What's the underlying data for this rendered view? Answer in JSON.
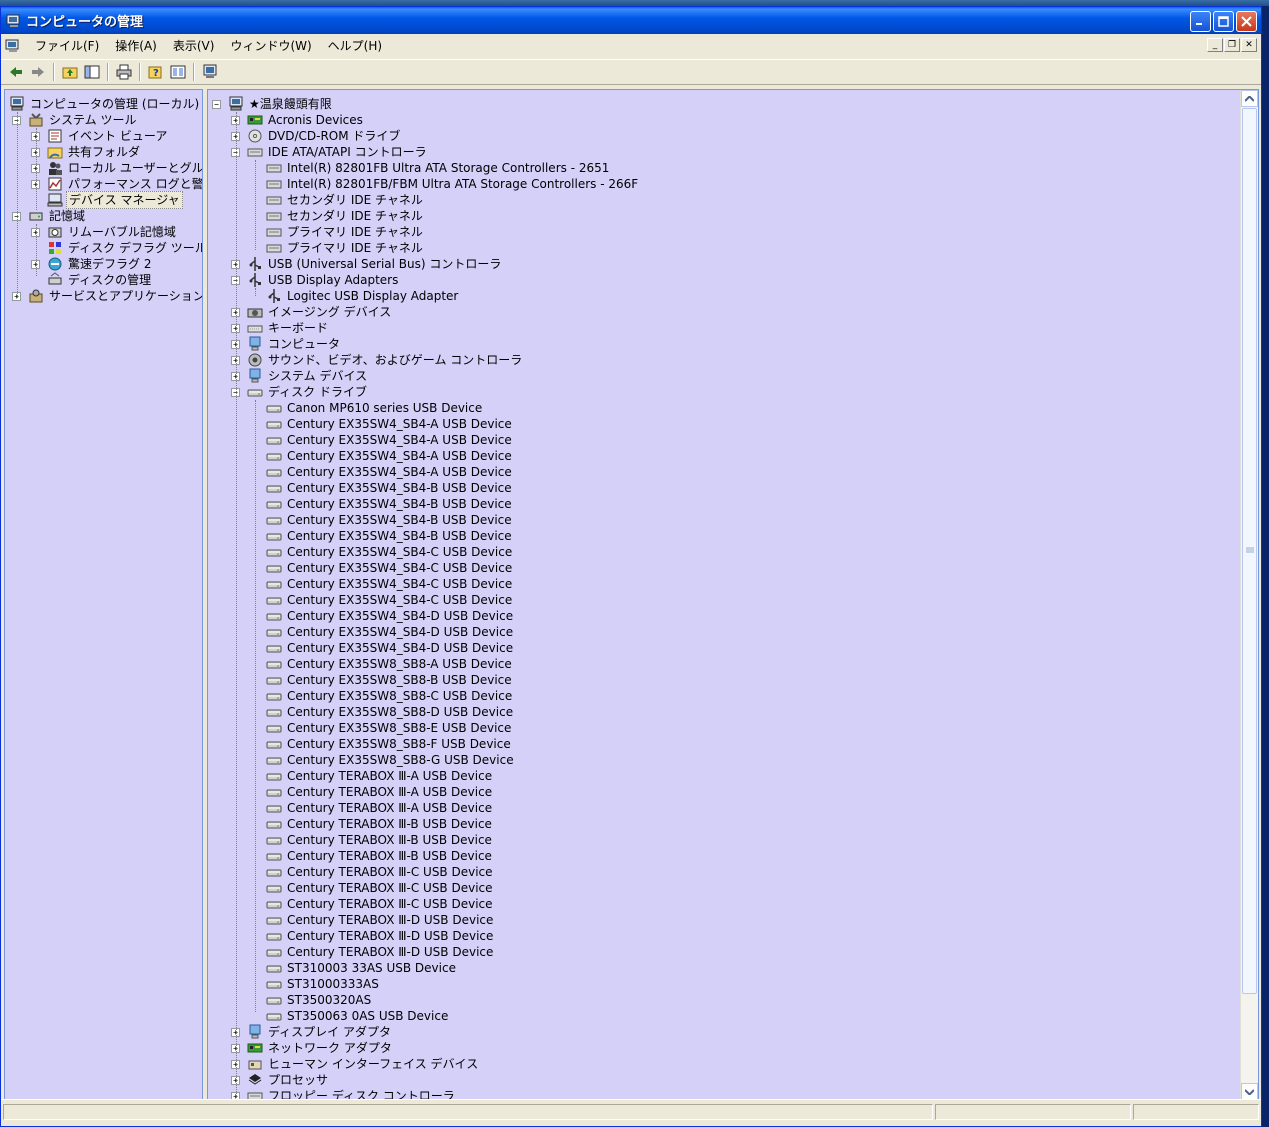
{
  "window": {
    "title": "コンピュータの管理"
  },
  "menu": [
    "ファイル(F)",
    "操作(A)",
    "表示(V)",
    "ウィンドウ(W)",
    "ヘルプ(H)"
  ],
  "toolbar": [
    "back-arrow-icon",
    "forward-arrow-icon",
    "up-folder-icon",
    "show-tree-icon",
    "print-icon",
    "help-icon",
    "properties-icon",
    "computer-icon"
  ],
  "left_tree": [
    {
      "label": "コンピュータの管理 (ローカル)",
      "level": 0,
      "icon": "computer-icon",
      "exp": ""
    },
    {
      "label": "システム ツール",
      "level": 1,
      "icon": "tools-icon",
      "exp": "-"
    },
    {
      "label": "イベント ビューア",
      "level": 2,
      "icon": "event-viewer-icon",
      "exp": "+"
    },
    {
      "label": "共有フォルダ",
      "level": 2,
      "icon": "shared-folder-icon",
      "exp": "+"
    },
    {
      "label": "ローカル ユーザーとグループ",
      "level": 2,
      "icon": "users-icon",
      "exp": "+"
    },
    {
      "label": "パフォーマンス ログと警告",
      "level": 2,
      "icon": "performance-icon",
      "exp": "+"
    },
    {
      "label": "デバイス マネージャ",
      "level": 2,
      "icon": "device-manager-icon",
      "exp": "",
      "selected": true
    },
    {
      "label": "記憶域",
      "level": 1,
      "icon": "storage-icon",
      "exp": "-"
    },
    {
      "label": "リムーバブル記憶域",
      "level": 2,
      "icon": "removable-storage-icon",
      "exp": "+"
    },
    {
      "label": "ディスク デフラグ ツール",
      "level": 2,
      "icon": "defrag-icon",
      "exp": ""
    },
    {
      "label": "驚速デフラグ 2",
      "level": 2,
      "icon": "defrag2-icon",
      "exp": "+"
    },
    {
      "label": "ディスクの管理",
      "level": 2,
      "icon": "disk-management-icon",
      "exp": ""
    },
    {
      "label": "サービスとアプリケーション",
      "level": 1,
      "icon": "services-icon",
      "exp": "+"
    }
  ],
  "right_tree": [
    {
      "label": "★温泉饅頭有限",
      "level": 0,
      "icon": "computer-icon",
      "exp": "-"
    },
    {
      "label": "Acronis Devices",
      "level": 1,
      "icon": "board-icon",
      "exp": "+"
    },
    {
      "label": "DVD/CD-ROM ドライブ",
      "level": 1,
      "icon": "cdrom-icon",
      "exp": "+"
    },
    {
      "label": "IDE ATA/ATAPI コントローラ",
      "level": 1,
      "icon": "ide-icon",
      "exp": "-"
    },
    {
      "label": "Intel(R) 82801FB Ultra ATA Storage Controllers - 2651",
      "level": 2,
      "icon": "ide-icon",
      "exp": ""
    },
    {
      "label": "Intel(R) 82801FB/FBM Ultra ATA Storage Controllers - 266F",
      "level": 2,
      "icon": "ide-icon",
      "exp": ""
    },
    {
      "label": "セカンダリ IDE チャネル",
      "level": 2,
      "icon": "ide-icon",
      "exp": ""
    },
    {
      "label": "セカンダリ IDE チャネル",
      "level": 2,
      "icon": "ide-icon",
      "exp": ""
    },
    {
      "label": "プライマリ IDE チャネル",
      "level": 2,
      "icon": "ide-icon",
      "exp": ""
    },
    {
      "label": "プライマリ IDE チャネル",
      "level": 2,
      "icon": "ide-icon",
      "exp": ""
    },
    {
      "label": "USB (Universal Serial Bus) コントローラ",
      "level": 1,
      "icon": "usb-icon",
      "exp": "+"
    },
    {
      "label": "USB Display Adapters",
      "level": 1,
      "icon": "usb-icon",
      "exp": "-"
    },
    {
      "label": "Logitec USB Display Adapter",
      "level": 2,
      "icon": "usb-icon",
      "exp": ""
    },
    {
      "label": "イメージング デバイス",
      "level": 1,
      "icon": "camera-icon",
      "exp": "+"
    },
    {
      "label": "キーボード",
      "level": 1,
      "icon": "keyboard-icon",
      "exp": "+"
    },
    {
      "label": "コンピュータ",
      "level": 1,
      "icon": "monitor-icon",
      "exp": "+"
    },
    {
      "label": "サウンド、ビデオ、およびゲーム コントローラ",
      "level": 1,
      "icon": "sound-icon",
      "exp": "+"
    },
    {
      "label": "システム デバイス",
      "level": 1,
      "icon": "monitor-icon",
      "exp": "+"
    },
    {
      "label": "ディスク ドライブ",
      "level": 1,
      "icon": "disk-icon",
      "exp": "-"
    },
    {
      "label": "Canon MP610 series USB Device",
      "level": 2,
      "icon": "disk-icon",
      "exp": ""
    },
    {
      "label": "Century EX35SW4_SB4-A USB Device",
      "level": 2,
      "icon": "disk-icon",
      "exp": ""
    },
    {
      "label": "Century EX35SW4_SB4-A USB Device",
      "level": 2,
      "icon": "disk-icon",
      "exp": ""
    },
    {
      "label": "Century EX35SW4_SB4-A USB Device",
      "level": 2,
      "icon": "disk-icon",
      "exp": ""
    },
    {
      "label": "Century EX35SW4_SB4-A USB Device",
      "level": 2,
      "icon": "disk-icon",
      "exp": ""
    },
    {
      "label": "Century EX35SW4_SB4-B USB Device",
      "level": 2,
      "icon": "disk-icon",
      "exp": ""
    },
    {
      "label": "Century EX35SW4_SB4-B USB Device",
      "level": 2,
      "icon": "disk-icon",
      "exp": ""
    },
    {
      "label": "Century EX35SW4_SB4-B USB Device",
      "level": 2,
      "icon": "disk-icon",
      "exp": ""
    },
    {
      "label": "Century EX35SW4_SB4-B USB Device",
      "level": 2,
      "icon": "disk-icon",
      "exp": ""
    },
    {
      "label": "Century EX35SW4_SB4-C USB Device",
      "level": 2,
      "icon": "disk-icon",
      "exp": ""
    },
    {
      "label": "Century EX35SW4_SB4-C USB Device",
      "level": 2,
      "icon": "disk-icon",
      "exp": ""
    },
    {
      "label": "Century EX35SW4_SB4-C USB Device",
      "level": 2,
      "icon": "disk-icon",
      "exp": ""
    },
    {
      "label": "Century EX35SW4_SB4-C USB Device",
      "level": 2,
      "icon": "disk-icon",
      "exp": ""
    },
    {
      "label": "Century EX35SW4_SB4-D USB Device",
      "level": 2,
      "icon": "disk-icon",
      "exp": ""
    },
    {
      "label": "Century EX35SW4_SB4-D USB Device",
      "level": 2,
      "icon": "disk-icon",
      "exp": ""
    },
    {
      "label": "Century EX35SW4_SB4-D USB Device",
      "level": 2,
      "icon": "disk-icon",
      "exp": ""
    },
    {
      "label": "Century EX35SW8_SB8-A USB Device",
      "level": 2,
      "icon": "disk-icon",
      "exp": ""
    },
    {
      "label": "Century EX35SW8_SB8-B USB Device",
      "level": 2,
      "icon": "disk-icon",
      "exp": ""
    },
    {
      "label": "Century EX35SW8_SB8-C USB Device",
      "level": 2,
      "icon": "disk-icon",
      "exp": ""
    },
    {
      "label": "Century EX35SW8_SB8-D USB Device",
      "level": 2,
      "icon": "disk-icon",
      "exp": ""
    },
    {
      "label": "Century EX35SW8_SB8-E USB Device",
      "level": 2,
      "icon": "disk-icon",
      "exp": ""
    },
    {
      "label": "Century EX35SW8_SB8-F USB Device",
      "level": 2,
      "icon": "disk-icon",
      "exp": ""
    },
    {
      "label": "Century EX35SW8_SB8-G USB Device",
      "level": 2,
      "icon": "disk-icon",
      "exp": ""
    },
    {
      "label": "Century TERABOX Ⅲ-A USB Device",
      "level": 2,
      "icon": "disk-icon",
      "exp": ""
    },
    {
      "label": "Century TERABOX Ⅲ-A USB Device",
      "level": 2,
      "icon": "disk-icon",
      "exp": ""
    },
    {
      "label": "Century TERABOX Ⅲ-A USB Device",
      "level": 2,
      "icon": "disk-icon",
      "exp": ""
    },
    {
      "label": "Century TERABOX Ⅲ-B USB Device",
      "level": 2,
      "icon": "disk-icon",
      "exp": ""
    },
    {
      "label": "Century TERABOX Ⅲ-B USB Device",
      "level": 2,
      "icon": "disk-icon",
      "exp": ""
    },
    {
      "label": "Century TERABOX Ⅲ-B USB Device",
      "level": 2,
      "icon": "disk-icon",
      "exp": ""
    },
    {
      "label": "Century TERABOX Ⅲ-C USB Device",
      "level": 2,
      "icon": "disk-icon",
      "exp": ""
    },
    {
      "label": "Century TERABOX Ⅲ-C USB Device",
      "level": 2,
      "icon": "disk-icon",
      "exp": ""
    },
    {
      "label": "Century TERABOX Ⅲ-C USB Device",
      "level": 2,
      "icon": "disk-icon",
      "exp": ""
    },
    {
      "label": "Century TERABOX Ⅲ-D USB Device",
      "level": 2,
      "icon": "disk-icon",
      "exp": ""
    },
    {
      "label": "Century TERABOX Ⅲ-D USB Device",
      "level": 2,
      "icon": "disk-icon",
      "exp": ""
    },
    {
      "label": "Century TERABOX Ⅲ-D USB Device",
      "level": 2,
      "icon": "disk-icon",
      "exp": ""
    },
    {
      "label": "ST310003 33AS USB Device",
      "level": 2,
      "icon": "disk-icon",
      "exp": ""
    },
    {
      "label": "ST31000333AS",
      "level": 2,
      "icon": "disk-icon",
      "exp": ""
    },
    {
      "label": "ST3500320AS",
      "level": 2,
      "icon": "disk-icon",
      "exp": ""
    },
    {
      "label": "ST350063 0AS USB Device",
      "level": 2,
      "icon": "disk-icon",
      "exp": ""
    },
    {
      "label": "ディスプレイ アダプタ",
      "level": 1,
      "icon": "monitor-icon",
      "exp": "+"
    },
    {
      "label": "ネットワーク アダプタ",
      "level": 1,
      "icon": "board-icon",
      "exp": "+"
    },
    {
      "label": "ヒューマン インターフェイス デバイス",
      "level": 1,
      "icon": "hid-icon",
      "exp": "+"
    },
    {
      "label": "プロセッサ",
      "level": 1,
      "icon": "cpu-icon",
      "exp": "+"
    },
    {
      "label": "フロッピー ディスク コントローラ",
      "level": 1,
      "icon": "ide-icon",
      "exp": "+"
    }
  ],
  "colors": {
    "pane_bg": "#d4d0f8",
    "titlebar": "#0058e6",
    "chrome": "#ece9d8"
  }
}
